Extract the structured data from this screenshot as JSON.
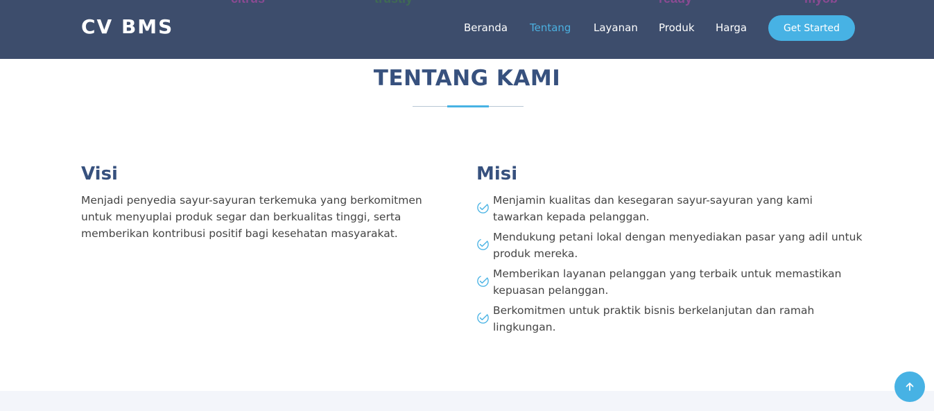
{
  "header": {
    "logo": "CV BMS",
    "nav": [
      {
        "label": "Beranda",
        "active": false
      },
      {
        "label": "Tentang",
        "active": true
      },
      {
        "label": "Layanan",
        "active": false
      },
      {
        "label": "Produk",
        "active": false
      },
      {
        "label": "Harga",
        "active": false
      }
    ],
    "cta_label": "Get Started",
    "partners": [
      "",
      "citrus",
      "trustly",
      "",
      "ready",
      "myob"
    ]
  },
  "section": {
    "title": "TENTANG KAMI"
  },
  "visi": {
    "heading": "Visi",
    "text": "Menjadi penyedia sayur-sayuran terkemuka yang berkomitmen untuk menyuplai produk segar dan berkualitas tinggi, serta memberikan kontribusi positif bagi kesehatan masyarakat."
  },
  "misi": {
    "heading": "Misi",
    "items": [
      "Menjamin kualitas dan kesegaran sayur-sayuran yang kami tawarkan kepada pelanggan.",
      "Mendukung petani lokal dengan menyediakan pasar yang adil untuk produk mereka.",
      "Memberikan layanan pelanggan yang terbaik untuk memastikan kepuasan pelanggan.",
      "Berkomitmen untuk praktik bisnis berkelanjutan dan ramah lingkungan."
    ]
  },
  "icons": {
    "check": "check-circle-icon",
    "back_to_top": "arrow-up-icon"
  },
  "colors": {
    "header_bg": "#3d4d6c",
    "accent": "#47b2e4",
    "heading": "#37517e",
    "text": "#444444"
  }
}
